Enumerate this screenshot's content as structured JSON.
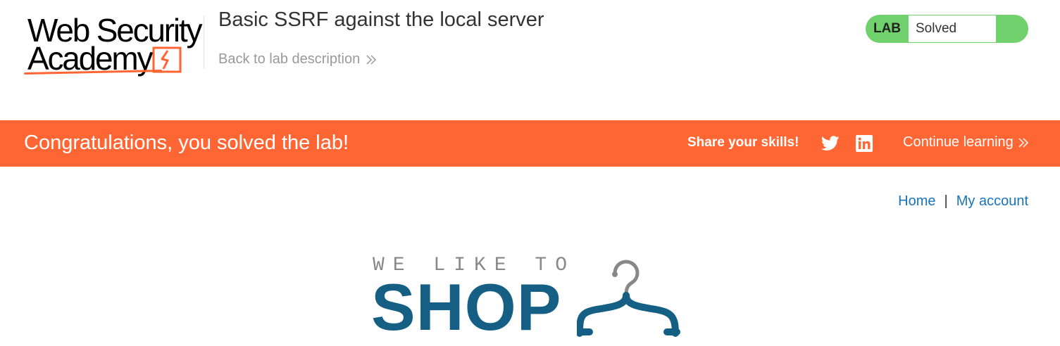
{
  "header": {
    "logo": {
      "line1": "Web Security",
      "line2": "Academy"
    },
    "lab_title": "Basic SSRF against the local server",
    "back_link": "Back to lab description"
  },
  "status": {
    "label": "LAB",
    "value": "Solved",
    "color": "#70d16d"
  },
  "banner": {
    "message": "Congratulations, you solved the lab!",
    "share": "Share your skills!",
    "icons": [
      "twitter-icon",
      "linkedin-icon"
    ],
    "continue": "Continue learning",
    "color": "#ff6633"
  },
  "nav": {
    "home": "Home",
    "separator": "|",
    "account": "My account",
    "link_color": "#1a73b8"
  },
  "shop_logo": {
    "tagline": "WE LIKE TO",
    "word": "SHOP",
    "color": "#155f85"
  }
}
